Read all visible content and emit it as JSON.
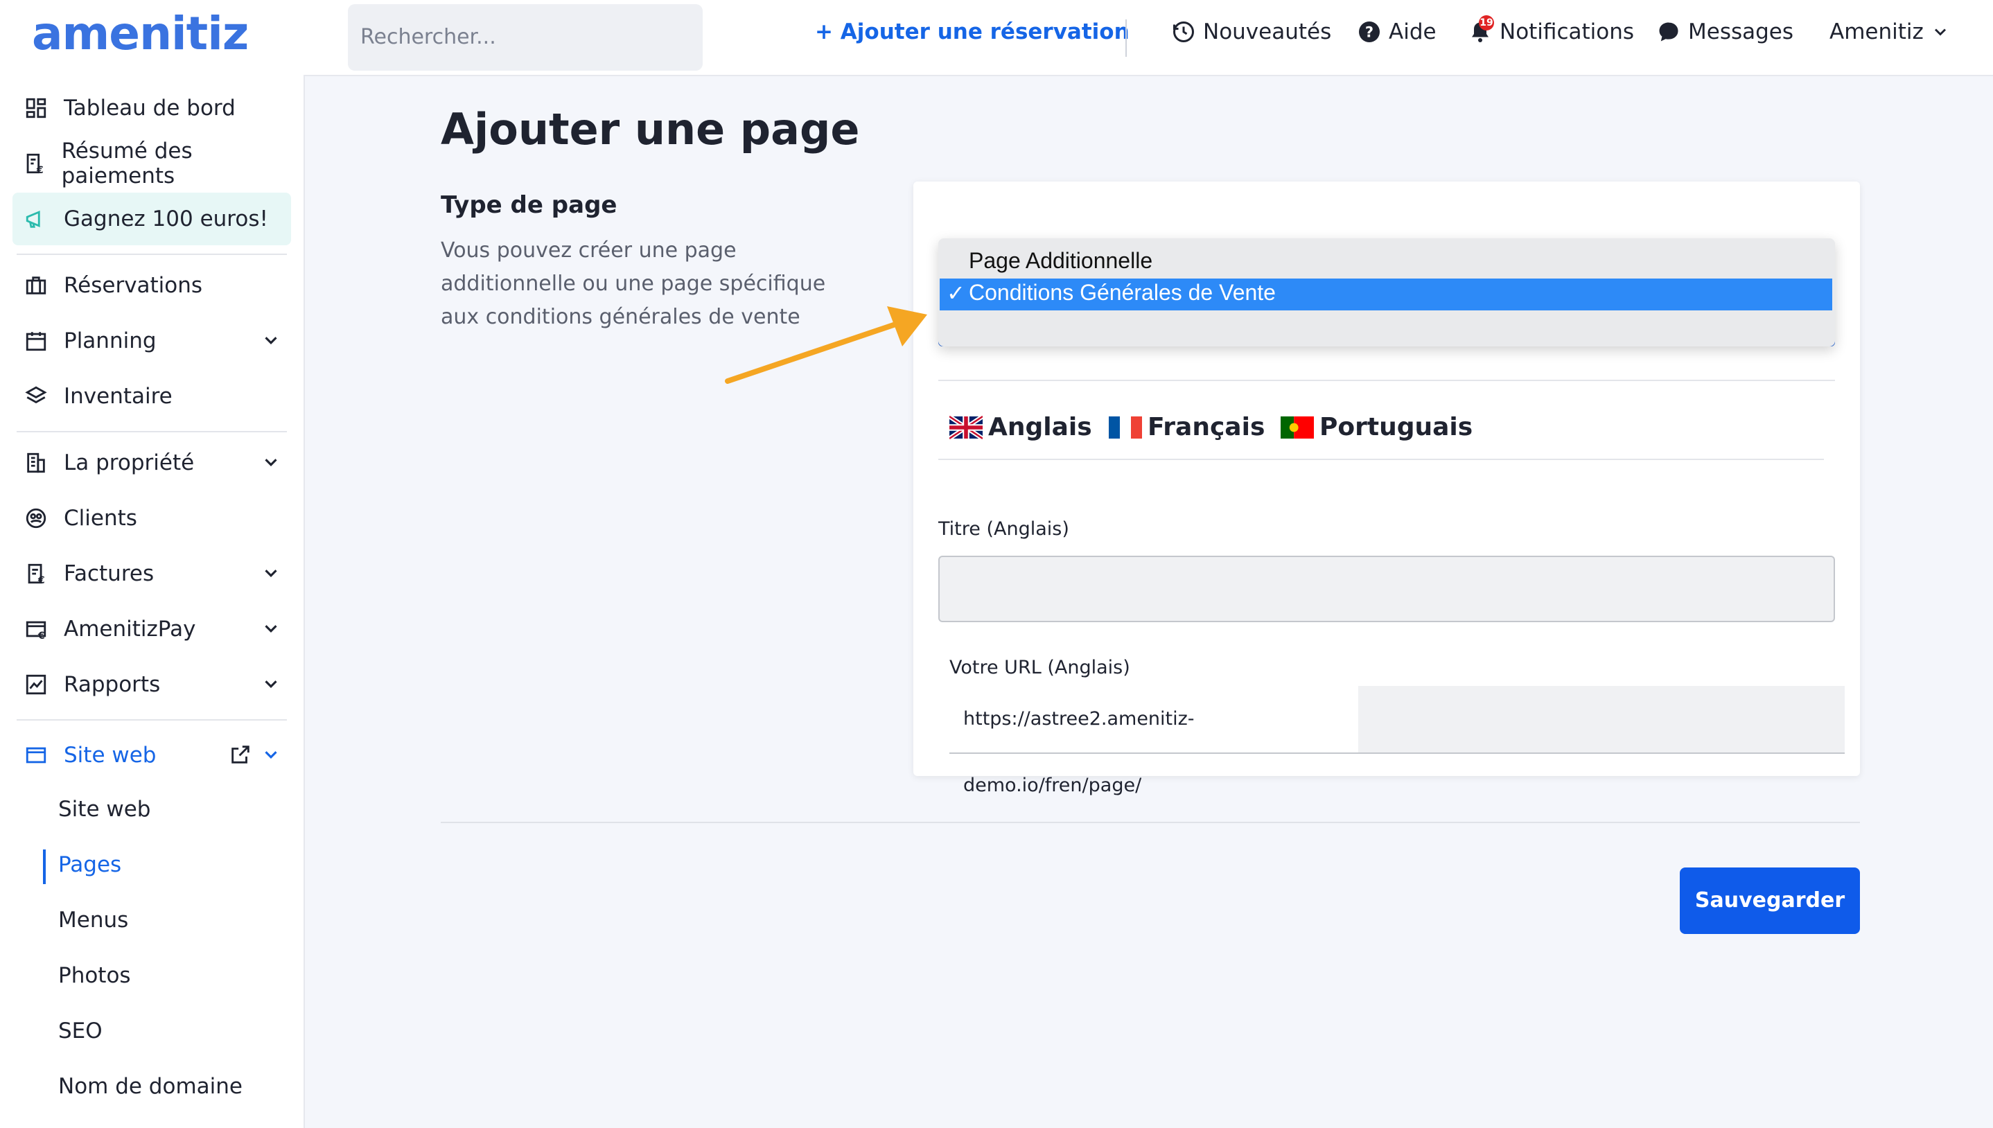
{
  "brand": {
    "logo": "amenitiz",
    "accent": "#1565e6",
    "logo_color": "#3a73e0"
  },
  "header": {
    "search_placeholder": "Rechercher...",
    "add_reservation": "Ajouter une réservation",
    "nav": {
      "news": "Nouveautés",
      "help": "Aide",
      "notifications": "Notifications",
      "notifications_count": "19",
      "messages": "Messages",
      "account": "Amenitiz"
    }
  },
  "sidebar": {
    "items": [
      {
        "label": "Tableau de bord",
        "icon": "dashboard-icon"
      },
      {
        "label": "Résumé des paiements",
        "icon": "payments-summary-icon"
      },
      {
        "label": "Gagnez 100 euros!",
        "icon": "megaphone-icon"
      },
      {
        "label": "Réservations",
        "icon": "briefcase-icon"
      },
      {
        "label": "Planning",
        "icon": "calendar-icon"
      },
      {
        "label": "Inventaire",
        "icon": "layers-icon"
      },
      {
        "label": "La propriété",
        "icon": "building-icon"
      },
      {
        "label": "Clients",
        "icon": "clients-icon"
      },
      {
        "label": "Factures",
        "icon": "invoice-icon"
      },
      {
        "label": "AmenitizPay",
        "icon": "card-icon"
      },
      {
        "label": "Rapports",
        "icon": "chart-icon"
      },
      {
        "label": "Site web",
        "icon": "browser-icon"
      }
    ],
    "website_sub": [
      "Site web",
      "Pages",
      "Menus",
      "Photos",
      "SEO",
      "Nom de domaine"
    ]
  },
  "main": {
    "title": "Ajouter une page",
    "section_title": "Type de page",
    "section_desc": "Vous pouvez créer une page additionnelle ou une page spécifique aux conditions générales de vente",
    "page_type": {
      "options": [
        "Page Additionnelle",
        "Conditions Générales de Vente"
      ],
      "selected": "Conditions Générales de Vente",
      "check_mark": "✓"
    },
    "languages": [
      "Anglais",
      "Français",
      "Portuguais"
    ],
    "title_label": "Titre (Anglais)",
    "title_value": "",
    "url_label": "Votre URL (Anglais)",
    "url_prefix": "https://astree2.amenitiz-demo.io/fren/page/",
    "save": "Sauvegarder"
  }
}
